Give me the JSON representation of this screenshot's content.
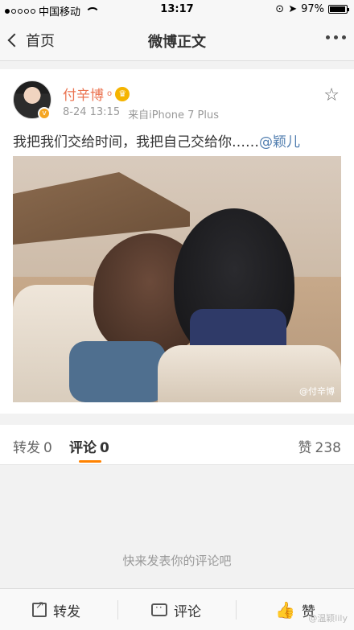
{
  "status_bar": {
    "carrier": "中国移动",
    "time": "13:17",
    "battery": "97%",
    "battery_level": 0.97
  },
  "nav": {
    "back_label": "首页",
    "title": "微博正文"
  },
  "post": {
    "username": "付辛博",
    "username_suffix": "o",
    "date": "8-24 13:15",
    "source": "来自iPhone 7 Plus",
    "text": "我把我们交给时间，我把自己交给你……",
    "mention": "@颖儿",
    "photo_watermark": "@付辛博",
    "icons": {
      "verified": "verified-badge-icon",
      "vip": "crown-icon",
      "favorite": "star-icon"
    }
  },
  "tabs": {
    "repost_label": "转发",
    "repost_count": "0",
    "comment_label": "评论",
    "comment_count": "0",
    "like_label": "赞",
    "like_count": "238"
  },
  "empty_comments": {
    "message": "快来发表你的评论吧"
  },
  "toolbar": {
    "repost_label": "转发",
    "comment_label": "评论",
    "like_label": "赞",
    "watermark": "@温颖lily"
  },
  "colors": {
    "username": "#eb7350",
    "mention": "#507daf",
    "tab_underline": "#ff8200"
  }
}
